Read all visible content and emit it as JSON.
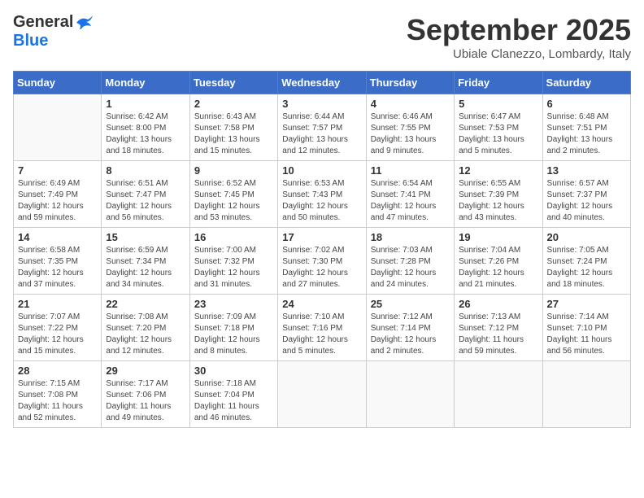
{
  "header": {
    "logo_general": "General",
    "logo_blue": "Blue",
    "month_title": "September 2025",
    "subtitle": "Ubiale Clanezzo, Lombardy, Italy"
  },
  "calendar": {
    "days_of_week": [
      "Sunday",
      "Monday",
      "Tuesday",
      "Wednesday",
      "Thursday",
      "Friday",
      "Saturday"
    ],
    "weeks": [
      [
        {
          "day": "",
          "info": ""
        },
        {
          "day": "1",
          "info": "Sunrise: 6:42 AM\nSunset: 8:00 PM\nDaylight: 13 hours\nand 18 minutes."
        },
        {
          "day": "2",
          "info": "Sunrise: 6:43 AM\nSunset: 7:58 PM\nDaylight: 13 hours\nand 15 minutes."
        },
        {
          "day": "3",
          "info": "Sunrise: 6:44 AM\nSunset: 7:57 PM\nDaylight: 13 hours\nand 12 minutes."
        },
        {
          "day": "4",
          "info": "Sunrise: 6:46 AM\nSunset: 7:55 PM\nDaylight: 13 hours\nand 9 minutes."
        },
        {
          "day": "5",
          "info": "Sunrise: 6:47 AM\nSunset: 7:53 PM\nDaylight: 13 hours\nand 5 minutes."
        },
        {
          "day": "6",
          "info": "Sunrise: 6:48 AM\nSunset: 7:51 PM\nDaylight: 13 hours\nand 2 minutes."
        }
      ],
      [
        {
          "day": "7",
          "info": "Sunrise: 6:49 AM\nSunset: 7:49 PM\nDaylight: 12 hours\nand 59 minutes."
        },
        {
          "day": "8",
          "info": "Sunrise: 6:51 AM\nSunset: 7:47 PM\nDaylight: 12 hours\nand 56 minutes."
        },
        {
          "day": "9",
          "info": "Sunrise: 6:52 AM\nSunset: 7:45 PM\nDaylight: 12 hours\nand 53 minutes."
        },
        {
          "day": "10",
          "info": "Sunrise: 6:53 AM\nSunset: 7:43 PM\nDaylight: 12 hours\nand 50 minutes."
        },
        {
          "day": "11",
          "info": "Sunrise: 6:54 AM\nSunset: 7:41 PM\nDaylight: 12 hours\nand 47 minutes."
        },
        {
          "day": "12",
          "info": "Sunrise: 6:55 AM\nSunset: 7:39 PM\nDaylight: 12 hours\nand 43 minutes."
        },
        {
          "day": "13",
          "info": "Sunrise: 6:57 AM\nSunset: 7:37 PM\nDaylight: 12 hours\nand 40 minutes."
        }
      ],
      [
        {
          "day": "14",
          "info": "Sunrise: 6:58 AM\nSunset: 7:35 PM\nDaylight: 12 hours\nand 37 minutes."
        },
        {
          "day": "15",
          "info": "Sunrise: 6:59 AM\nSunset: 7:34 PM\nDaylight: 12 hours\nand 34 minutes."
        },
        {
          "day": "16",
          "info": "Sunrise: 7:00 AM\nSunset: 7:32 PM\nDaylight: 12 hours\nand 31 minutes."
        },
        {
          "day": "17",
          "info": "Sunrise: 7:02 AM\nSunset: 7:30 PM\nDaylight: 12 hours\nand 27 minutes."
        },
        {
          "day": "18",
          "info": "Sunrise: 7:03 AM\nSunset: 7:28 PM\nDaylight: 12 hours\nand 24 minutes."
        },
        {
          "day": "19",
          "info": "Sunrise: 7:04 AM\nSunset: 7:26 PM\nDaylight: 12 hours\nand 21 minutes."
        },
        {
          "day": "20",
          "info": "Sunrise: 7:05 AM\nSunset: 7:24 PM\nDaylight: 12 hours\nand 18 minutes."
        }
      ],
      [
        {
          "day": "21",
          "info": "Sunrise: 7:07 AM\nSunset: 7:22 PM\nDaylight: 12 hours\nand 15 minutes."
        },
        {
          "day": "22",
          "info": "Sunrise: 7:08 AM\nSunset: 7:20 PM\nDaylight: 12 hours\nand 12 minutes."
        },
        {
          "day": "23",
          "info": "Sunrise: 7:09 AM\nSunset: 7:18 PM\nDaylight: 12 hours\nand 8 minutes."
        },
        {
          "day": "24",
          "info": "Sunrise: 7:10 AM\nSunset: 7:16 PM\nDaylight: 12 hours\nand 5 minutes."
        },
        {
          "day": "25",
          "info": "Sunrise: 7:12 AM\nSunset: 7:14 PM\nDaylight: 12 hours\nand 2 minutes."
        },
        {
          "day": "26",
          "info": "Sunrise: 7:13 AM\nSunset: 7:12 PM\nDaylight: 11 hours\nand 59 minutes."
        },
        {
          "day": "27",
          "info": "Sunrise: 7:14 AM\nSunset: 7:10 PM\nDaylight: 11 hours\nand 56 minutes."
        }
      ],
      [
        {
          "day": "28",
          "info": "Sunrise: 7:15 AM\nSunset: 7:08 PM\nDaylight: 11 hours\nand 52 minutes."
        },
        {
          "day": "29",
          "info": "Sunrise: 7:17 AM\nSunset: 7:06 PM\nDaylight: 11 hours\nand 49 minutes."
        },
        {
          "day": "30",
          "info": "Sunrise: 7:18 AM\nSunset: 7:04 PM\nDaylight: 11 hours\nand 46 minutes."
        },
        {
          "day": "",
          "info": ""
        },
        {
          "day": "",
          "info": ""
        },
        {
          "day": "",
          "info": ""
        },
        {
          "day": "",
          "info": ""
        }
      ]
    ]
  }
}
